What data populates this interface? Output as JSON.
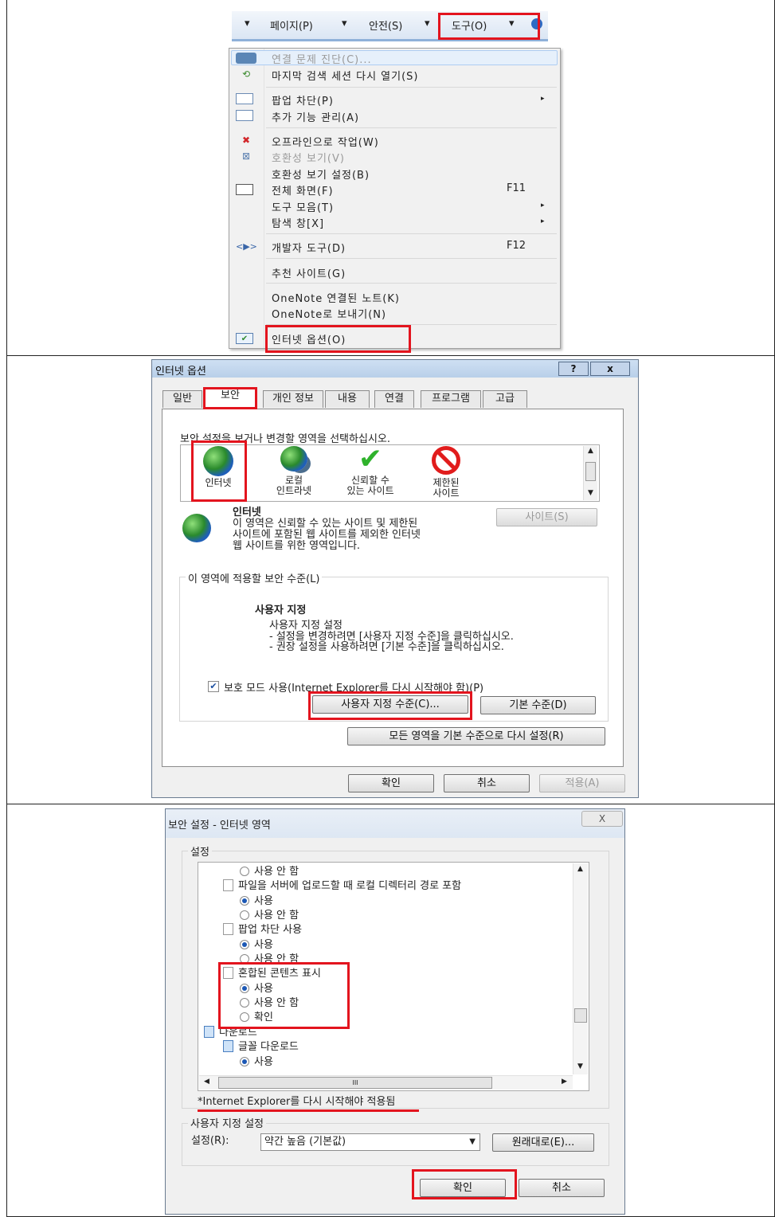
{
  "panel1": {
    "menubar": {
      "page": "페이지(P)",
      "safety": "안전(S)",
      "tools": "도구(O)"
    },
    "items": [
      {
        "label": "연결 문제 진단(C)...",
        "disabled": true
      },
      {
        "label": "마지막 검색 세션 다시 열기(S)"
      },
      {
        "label": "팝업 차단(P)",
        "arrow": "▸"
      },
      {
        "label": "추가 기능 관리(A)"
      },
      {
        "label": "오프라인으로 작업(W)"
      },
      {
        "label": "호환성 보기(V)",
        "disabled": true
      },
      {
        "label": "호환성 보기 설정(B)"
      },
      {
        "label": "전체 화면(F)",
        "shortcut": "F11"
      },
      {
        "label": "도구 모음(T)",
        "arrow": "▸"
      },
      {
        "label": "탐색 창[X]",
        "arrow": "▸"
      },
      {
        "label": "개발자 도구(D)",
        "shortcut": "F12"
      },
      {
        "label": "추천 사이트(G)"
      },
      {
        "label": "OneNote 연결된 노트(K)"
      },
      {
        "label": "OneNote로 보내기(N)"
      },
      {
        "label": "인터넷 옵션(O)"
      }
    ]
  },
  "panel2": {
    "title": "인터넷 옵션",
    "help_btn": "?",
    "close_btn": "x",
    "tabs": [
      "일반",
      "보안",
      "개인 정보",
      "내용",
      "연결",
      "프로그램",
      "고급"
    ],
    "instruction": "보안 설정을 보거나 변경할 영역을 선택하십시오.",
    "zones": [
      {
        "line1": "인터넷",
        "line2": ""
      },
      {
        "line1": "로컬",
        "line2": "인트라넷"
      },
      {
        "line1": "신뢰할 수",
        "line2": "있는 사이트"
      },
      {
        "line1": "제한된",
        "line2": "사이트"
      }
    ],
    "zone_title": "인터넷",
    "zone_desc": [
      "이 영역은 신뢰할 수 있는 사이트 및 제한된",
      "사이트에 포함된 웹 사이트를 제외한 인터넷",
      "웹 사이트를 위한 영역입니다."
    ],
    "sites_btn": "사이트(S)",
    "level_group": "이 영역에 적용할 보안 수준(L)",
    "level_name": "사용자 지정",
    "level_desc": [
      "사용자 지정 설정",
      "- 설정을 변경하려면 [사용자 지정 수준]을 클릭하십시오.",
      "- 권장 설정을 사용하려면 [기본 수준]을 클릭하십시오."
    ],
    "protected_mode": "보호 모드 사용(Internet Explorer를 다시 시작해야 함)(P)",
    "custom_level_btn": "사용자 지정 수준(C)...",
    "default_level_btn": "기본 수준(D)",
    "reset_all_btn": "모든 영역을 기본 수준으로 다시 설정(R)",
    "ok": "확인",
    "cancel": "취소",
    "apply": "적용(A)"
  },
  "panel3": {
    "title": "보안 설정 - 인터넷 영역",
    "close": "X",
    "settings_group": "설정",
    "tree": [
      {
        "type": "radio",
        "label": "사용 안 함",
        "checked": false
      },
      {
        "type": "item",
        "label": "파일을 서버에 업로드할 때 로컬 디렉터리 경로 포함"
      },
      {
        "type": "radio",
        "label": "사용",
        "checked": true
      },
      {
        "type": "radio",
        "label": "사용 안 함",
        "checked": false
      },
      {
        "type": "item",
        "label": "팝업 차단 사용"
      },
      {
        "type": "radio",
        "label": "사용",
        "checked": true
      },
      {
        "type": "radio",
        "label": "사용 안 함",
        "checked": false
      },
      {
        "type": "item",
        "label": "혼합된 콘텐츠 표시"
      },
      {
        "type": "radio",
        "label": "사용",
        "checked": true
      },
      {
        "type": "radio",
        "label": "사용 안 함",
        "checked": false
      },
      {
        "type": "radio",
        "label": "확인",
        "checked": false
      },
      {
        "type": "folder",
        "label": "다운로드"
      },
      {
        "type": "folder",
        "label": "글꼴 다운로드"
      },
      {
        "type": "radio",
        "label": "사용",
        "checked": true
      }
    ],
    "scroll_mark": "III",
    "restart_note": "*Internet Explorer를 다시 시작해야 적용됨",
    "custom_group": "사용자 지정 설정",
    "reset_label": "설정(R):",
    "reset_value": "약간 높음 (기본값)",
    "reset_btn": "원래대로(E)...",
    "ok": "확인",
    "cancel": "취소"
  }
}
